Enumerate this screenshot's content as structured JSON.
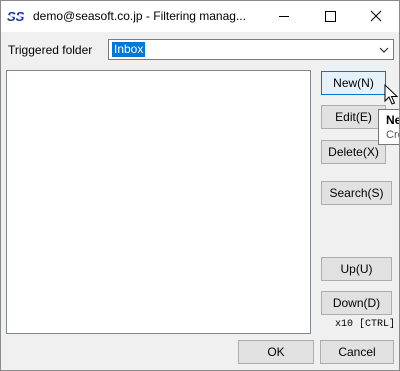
{
  "window": {
    "title": "demo@seasoft.co.jp - Filtering manag...",
    "app_icon": "seasoft-logo-icon",
    "caption_buttons": [
      "minimize-icon",
      "maximize-icon",
      "close-icon"
    ]
  },
  "folder": {
    "label": "Triggered folder",
    "selected": "Inbox"
  },
  "rules_list": {
    "items": []
  },
  "buttons": {
    "new": "New(N)",
    "edit": "Edit(E)",
    "delete": "Delete(X)",
    "search": "Search(S)",
    "up": "Up(U)",
    "down": "Down(D)",
    "ok": "OK",
    "cancel": "Cancel"
  },
  "hint": "x10 [CTRL]",
  "tooltip": {
    "title": "Ne",
    "text": "Cre"
  },
  "colors": {
    "accent": "#0078d7",
    "logo": "#1f2fa8"
  }
}
